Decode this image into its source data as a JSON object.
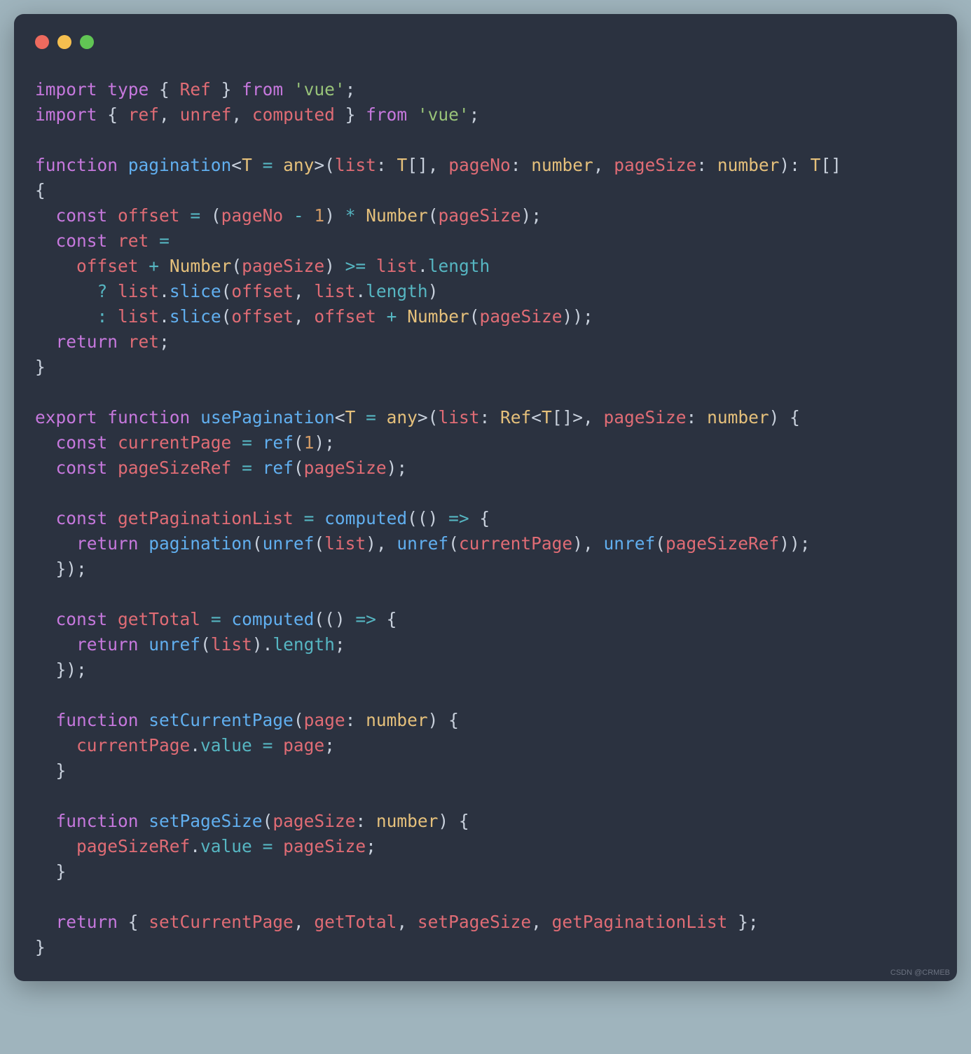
{
  "watermark": "CSDN @CRMEB",
  "code": {
    "lines": [
      [
        {
          "t": "import",
          "c": "kw"
        },
        {
          "t": " ",
          "c": "punc"
        },
        {
          "t": "type",
          "c": "kw"
        },
        {
          "t": " { ",
          "c": "punc"
        },
        {
          "t": "Ref",
          "c": "ident"
        },
        {
          "t": " } ",
          "c": "punc"
        },
        {
          "t": "from",
          "c": "kw"
        },
        {
          "t": " ",
          "c": "punc"
        },
        {
          "t": "'vue'",
          "c": "str"
        },
        {
          "t": ";",
          "c": "punc"
        }
      ],
      [
        {
          "t": "import",
          "c": "kw"
        },
        {
          "t": " { ",
          "c": "punc"
        },
        {
          "t": "ref",
          "c": "ident"
        },
        {
          "t": ", ",
          "c": "punc"
        },
        {
          "t": "unref",
          "c": "ident"
        },
        {
          "t": ", ",
          "c": "punc"
        },
        {
          "t": "computed",
          "c": "ident"
        },
        {
          "t": " } ",
          "c": "punc"
        },
        {
          "t": "from",
          "c": "kw"
        },
        {
          "t": " ",
          "c": "punc"
        },
        {
          "t": "'vue'",
          "c": "str"
        },
        {
          "t": ";",
          "c": "punc"
        }
      ],
      [],
      [
        {
          "t": "function",
          "c": "kw"
        },
        {
          "t": " ",
          "c": "punc"
        },
        {
          "t": "pagination",
          "c": "fn"
        },
        {
          "t": "<",
          "c": "punc"
        },
        {
          "t": "T",
          "c": "type"
        },
        {
          "t": " ",
          "c": "punc"
        },
        {
          "t": "=",
          "c": "op"
        },
        {
          "t": " ",
          "c": "punc"
        },
        {
          "t": "any",
          "c": "type"
        },
        {
          "t": ">(",
          "c": "punc"
        },
        {
          "t": "list",
          "c": "ident"
        },
        {
          "t": ": ",
          "c": "punc"
        },
        {
          "t": "T",
          "c": "type"
        },
        {
          "t": "[], ",
          "c": "punc"
        },
        {
          "t": "pageNo",
          "c": "ident"
        },
        {
          "t": ": ",
          "c": "punc"
        },
        {
          "t": "number",
          "c": "type"
        },
        {
          "t": ", ",
          "c": "punc"
        },
        {
          "t": "pageSize",
          "c": "ident"
        },
        {
          "t": ": ",
          "c": "punc"
        },
        {
          "t": "number",
          "c": "type"
        },
        {
          "t": "): ",
          "c": "punc"
        },
        {
          "t": "T",
          "c": "type"
        },
        {
          "t": "[] ",
          "c": "punc"
        }
      ],
      [
        {
          "t": "{",
          "c": "punc"
        }
      ],
      [
        {
          "t": "  ",
          "c": "punc"
        },
        {
          "t": "const",
          "c": "kw"
        },
        {
          "t": " ",
          "c": "punc"
        },
        {
          "t": "offset",
          "c": "ident"
        },
        {
          "t": " ",
          "c": "punc"
        },
        {
          "t": "=",
          "c": "op"
        },
        {
          "t": " (",
          "c": "punc"
        },
        {
          "t": "pageNo",
          "c": "ident"
        },
        {
          "t": " ",
          "c": "punc"
        },
        {
          "t": "-",
          "c": "op"
        },
        {
          "t": " ",
          "c": "punc"
        },
        {
          "t": "1",
          "c": "num"
        },
        {
          "t": ") ",
          "c": "punc"
        },
        {
          "t": "*",
          "c": "op"
        },
        {
          "t": " ",
          "c": "punc"
        },
        {
          "t": "Number",
          "c": "type"
        },
        {
          "t": "(",
          "c": "punc"
        },
        {
          "t": "pageSize",
          "c": "ident"
        },
        {
          "t": ");",
          "c": "punc"
        }
      ],
      [
        {
          "t": "  ",
          "c": "punc"
        },
        {
          "t": "const",
          "c": "kw"
        },
        {
          "t": " ",
          "c": "punc"
        },
        {
          "t": "ret",
          "c": "ident"
        },
        {
          "t": " ",
          "c": "punc"
        },
        {
          "t": "=",
          "c": "op"
        }
      ],
      [
        {
          "t": "    ",
          "c": "punc"
        },
        {
          "t": "offset",
          "c": "ident"
        },
        {
          "t": " ",
          "c": "punc"
        },
        {
          "t": "+",
          "c": "op"
        },
        {
          "t": " ",
          "c": "punc"
        },
        {
          "t": "Number",
          "c": "type"
        },
        {
          "t": "(",
          "c": "punc"
        },
        {
          "t": "pageSize",
          "c": "ident"
        },
        {
          "t": ") ",
          "c": "punc"
        },
        {
          "t": ">=",
          "c": "op"
        },
        {
          "t": " ",
          "c": "punc"
        },
        {
          "t": "list",
          "c": "ident"
        },
        {
          "t": ".",
          "c": "punc"
        },
        {
          "t": "length",
          "c": "prop"
        }
      ],
      [
        {
          "t": "      ",
          "c": "punc"
        },
        {
          "t": "?",
          "c": "op"
        },
        {
          "t": " ",
          "c": "punc"
        },
        {
          "t": "list",
          "c": "ident"
        },
        {
          "t": ".",
          "c": "punc"
        },
        {
          "t": "slice",
          "c": "fn"
        },
        {
          "t": "(",
          "c": "punc"
        },
        {
          "t": "offset",
          "c": "ident"
        },
        {
          "t": ", ",
          "c": "punc"
        },
        {
          "t": "list",
          "c": "ident"
        },
        {
          "t": ".",
          "c": "punc"
        },
        {
          "t": "length",
          "c": "prop"
        },
        {
          "t": ")",
          "c": "punc"
        }
      ],
      [
        {
          "t": "      ",
          "c": "punc"
        },
        {
          "t": ":",
          "c": "op"
        },
        {
          "t": " ",
          "c": "punc"
        },
        {
          "t": "list",
          "c": "ident"
        },
        {
          "t": ".",
          "c": "punc"
        },
        {
          "t": "slice",
          "c": "fn"
        },
        {
          "t": "(",
          "c": "punc"
        },
        {
          "t": "offset",
          "c": "ident"
        },
        {
          "t": ", ",
          "c": "punc"
        },
        {
          "t": "offset",
          "c": "ident"
        },
        {
          "t": " ",
          "c": "punc"
        },
        {
          "t": "+",
          "c": "op"
        },
        {
          "t": " ",
          "c": "punc"
        },
        {
          "t": "Number",
          "c": "type"
        },
        {
          "t": "(",
          "c": "punc"
        },
        {
          "t": "pageSize",
          "c": "ident"
        },
        {
          "t": "));",
          "c": "punc"
        }
      ],
      [
        {
          "t": "  ",
          "c": "punc"
        },
        {
          "t": "return",
          "c": "kw"
        },
        {
          "t": " ",
          "c": "punc"
        },
        {
          "t": "ret",
          "c": "ident"
        },
        {
          "t": ";",
          "c": "punc"
        }
      ],
      [
        {
          "t": "}",
          "c": "punc"
        }
      ],
      [],
      [
        {
          "t": "export",
          "c": "kw"
        },
        {
          "t": " ",
          "c": "punc"
        },
        {
          "t": "function",
          "c": "kw"
        },
        {
          "t": " ",
          "c": "punc"
        },
        {
          "t": "usePagination",
          "c": "fn"
        },
        {
          "t": "<",
          "c": "punc"
        },
        {
          "t": "T",
          "c": "type"
        },
        {
          "t": " ",
          "c": "punc"
        },
        {
          "t": "=",
          "c": "op"
        },
        {
          "t": " ",
          "c": "punc"
        },
        {
          "t": "any",
          "c": "type"
        },
        {
          "t": ">(",
          "c": "punc"
        },
        {
          "t": "list",
          "c": "ident"
        },
        {
          "t": ": ",
          "c": "punc"
        },
        {
          "t": "Ref",
          "c": "type"
        },
        {
          "t": "<",
          "c": "punc"
        },
        {
          "t": "T",
          "c": "type"
        },
        {
          "t": "[]>, ",
          "c": "punc"
        },
        {
          "t": "pageSize",
          "c": "ident"
        },
        {
          "t": ": ",
          "c": "punc"
        },
        {
          "t": "number",
          "c": "type"
        },
        {
          "t": ") {",
          "c": "punc"
        }
      ],
      [
        {
          "t": "  ",
          "c": "punc"
        },
        {
          "t": "const",
          "c": "kw"
        },
        {
          "t": " ",
          "c": "punc"
        },
        {
          "t": "currentPage",
          "c": "ident"
        },
        {
          "t": " ",
          "c": "punc"
        },
        {
          "t": "=",
          "c": "op"
        },
        {
          "t": " ",
          "c": "punc"
        },
        {
          "t": "ref",
          "c": "fn"
        },
        {
          "t": "(",
          "c": "punc"
        },
        {
          "t": "1",
          "c": "num"
        },
        {
          "t": ");",
          "c": "punc"
        }
      ],
      [
        {
          "t": "  ",
          "c": "punc"
        },
        {
          "t": "const",
          "c": "kw"
        },
        {
          "t": " ",
          "c": "punc"
        },
        {
          "t": "pageSizeRef",
          "c": "ident"
        },
        {
          "t": " ",
          "c": "punc"
        },
        {
          "t": "=",
          "c": "op"
        },
        {
          "t": " ",
          "c": "punc"
        },
        {
          "t": "ref",
          "c": "fn"
        },
        {
          "t": "(",
          "c": "punc"
        },
        {
          "t": "pageSize",
          "c": "ident"
        },
        {
          "t": ");",
          "c": "punc"
        }
      ],
      [],
      [
        {
          "t": "  ",
          "c": "punc"
        },
        {
          "t": "const",
          "c": "kw"
        },
        {
          "t": " ",
          "c": "punc"
        },
        {
          "t": "getPaginationList",
          "c": "ident"
        },
        {
          "t": " ",
          "c": "punc"
        },
        {
          "t": "=",
          "c": "op"
        },
        {
          "t": " ",
          "c": "punc"
        },
        {
          "t": "computed",
          "c": "fn"
        },
        {
          "t": "(() ",
          "c": "punc"
        },
        {
          "t": "=>",
          "c": "op"
        },
        {
          "t": " {",
          "c": "punc"
        }
      ],
      [
        {
          "t": "    ",
          "c": "punc"
        },
        {
          "t": "return",
          "c": "kw"
        },
        {
          "t": " ",
          "c": "punc"
        },
        {
          "t": "pagination",
          "c": "fn"
        },
        {
          "t": "(",
          "c": "punc"
        },
        {
          "t": "unref",
          "c": "fn"
        },
        {
          "t": "(",
          "c": "punc"
        },
        {
          "t": "list",
          "c": "ident"
        },
        {
          "t": "), ",
          "c": "punc"
        },
        {
          "t": "unref",
          "c": "fn"
        },
        {
          "t": "(",
          "c": "punc"
        },
        {
          "t": "currentPage",
          "c": "ident"
        },
        {
          "t": "), ",
          "c": "punc"
        },
        {
          "t": "unref",
          "c": "fn"
        },
        {
          "t": "(",
          "c": "punc"
        },
        {
          "t": "pageSizeRef",
          "c": "ident"
        },
        {
          "t": "));",
          "c": "punc"
        }
      ],
      [
        {
          "t": "  });",
          "c": "punc"
        }
      ],
      [],
      [
        {
          "t": "  ",
          "c": "punc"
        },
        {
          "t": "const",
          "c": "kw"
        },
        {
          "t": " ",
          "c": "punc"
        },
        {
          "t": "getTotal",
          "c": "ident"
        },
        {
          "t": " ",
          "c": "punc"
        },
        {
          "t": "=",
          "c": "op"
        },
        {
          "t": " ",
          "c": "punc"
        },
        {
          "t": "computed",
          "c": "fn"
        },
        {
          "t": "(() ",
          "c": "punc"
        },
        {
          "t": "=>",
          "c": "op"
        },
        {
          "t": " {",
          "c": "punc"
        }
      ],
      [
        {
          "t": "    ",
          "c": "punc"
        },
        {
          "t": "return",
          "c": "kw"
        },
        {
          "t": " ",
          "c": "punc"
        },
        {
          "t": "unref",
          "c": "fn"
        },
        {
          "t": "(",
          "c": "punc"
        },
        {
          "t": "list",
          "c": "ident"
        },
        {
          "t": ").",
          "c": "punc"
        },
        {
          "t": "length",
          "c": "prop"
        },
        {
          "t": ";",
          "c": "punc"
        }
      ],
      [
        {
          "t": "  });",
          "c": "punc"
        }
      ],
      [],
      [
        {
          "t": "  ",
          "c": "punc"
        },
        {
          "t": "function",
          "c": "kw"
        },
        {
          "t": " ",
          "c": "punc"
        },
        {
          "t": "setCurrentPage",
          "c": "fn"
        },
        {
          "t": "(",
          "c": "punc"
        },
        {
          "t": "page",
          "c": "ident"
        },
        {
          "t": ": ",
          "c": "punc"
        },
        {
          "t": "number",
          "c": "type"
        },
        {
          "t": ") {",
          "c": "punc"
        }
      ],
      [
        {
          "t": "    ",
          "c": "punc"
        },
        {
          "t": "currentPage",
          "c": "ident"
        },
        {
          "t": ".",
          "c": "punc"
        },
        {
          "t": "value",
          "c": "prop"
        },
        {
          "t": " ",
          "c": "punc"
        },
        {
          "t": "=",
          "c": "op"
        },
        {
          "t": " ",
          "c": "punc"
        },
        {
          "t": "page",
          "c": "ident"
        },
        {
          "t": ";",
          "c": "punc"
        }
      ],
      [
        {
          "t": "  }",
          "c": "punc"
        }
      ],
      [],
      [
        {
          "t": "  ",
          "c": "punc"
        },
        {
          "t": "function",
          "c": "kw"
        },
        {
          "t": " ",
          "c": "punc"
        },
        {
          "t": "setPageSize",
          "c": "fn"
        },
        {
          "t": "(",
          "c": "punc"
        },
        {
          "t": "pageSize",
          "c": "ident"
        },
        {
          "t": ": ",
          "c": "punc"
        },
        {
          "t": "number",
          "c": "type"
        },
        {
          "t": ") {",
          "c": "punc"
        }
      ],
      [
        {
          "t": "    ",
          "c": "punc"
        },
        {
          "t": "pageSizeRef",
          "c": "ident"
        },
        {
          "t": ".",
          "c": "punc"
        },
        {
          "t": "value",
          "c": "prop"
        },
        {
          "t": " ",
          "c": "punc"
        },
        {
          "t": "=",
          "c": "op"
        },
        {
          "t": " ",
          "c": "punc"
        },
        {
          "t": "pageSize",
          "c": "ident"
        },
        {
          "t": ";",
          "c": "punc"
        }
      ],
      [
        {
          "t": "  }",
          "c": "punc"
        }
      ],
      [],
      [
        {
          "t": "  ",
          "c": "punc"
        },
        {
          "t": "return",
          "c": "kw"
        },
        {
          "t": " { ",
          "c": "punc"
        },
        {
          "t": "setCurrentPage",
          "c": "ident"
        },
        {
          "t": ", ",
          "c": "punc"
        },
        {
          "t": "getTotal",
          "c": "ident"
        },
        {
          "t": ", ",
          "c": "punc"
        },
        {
          "t": "setPageSize",
          "c": "ident"
        },
        {
          "t": ", ",
          "c": "punc"
        },
        {
          "t": "getPaginationList",
          "c": "ident"
        },
        {
          "t": " };",
          "c": "punc"
        }
      ],
      [
        {
          "t": "}",
          "c": "punc"
        }
      ]
    ]
  }
}
